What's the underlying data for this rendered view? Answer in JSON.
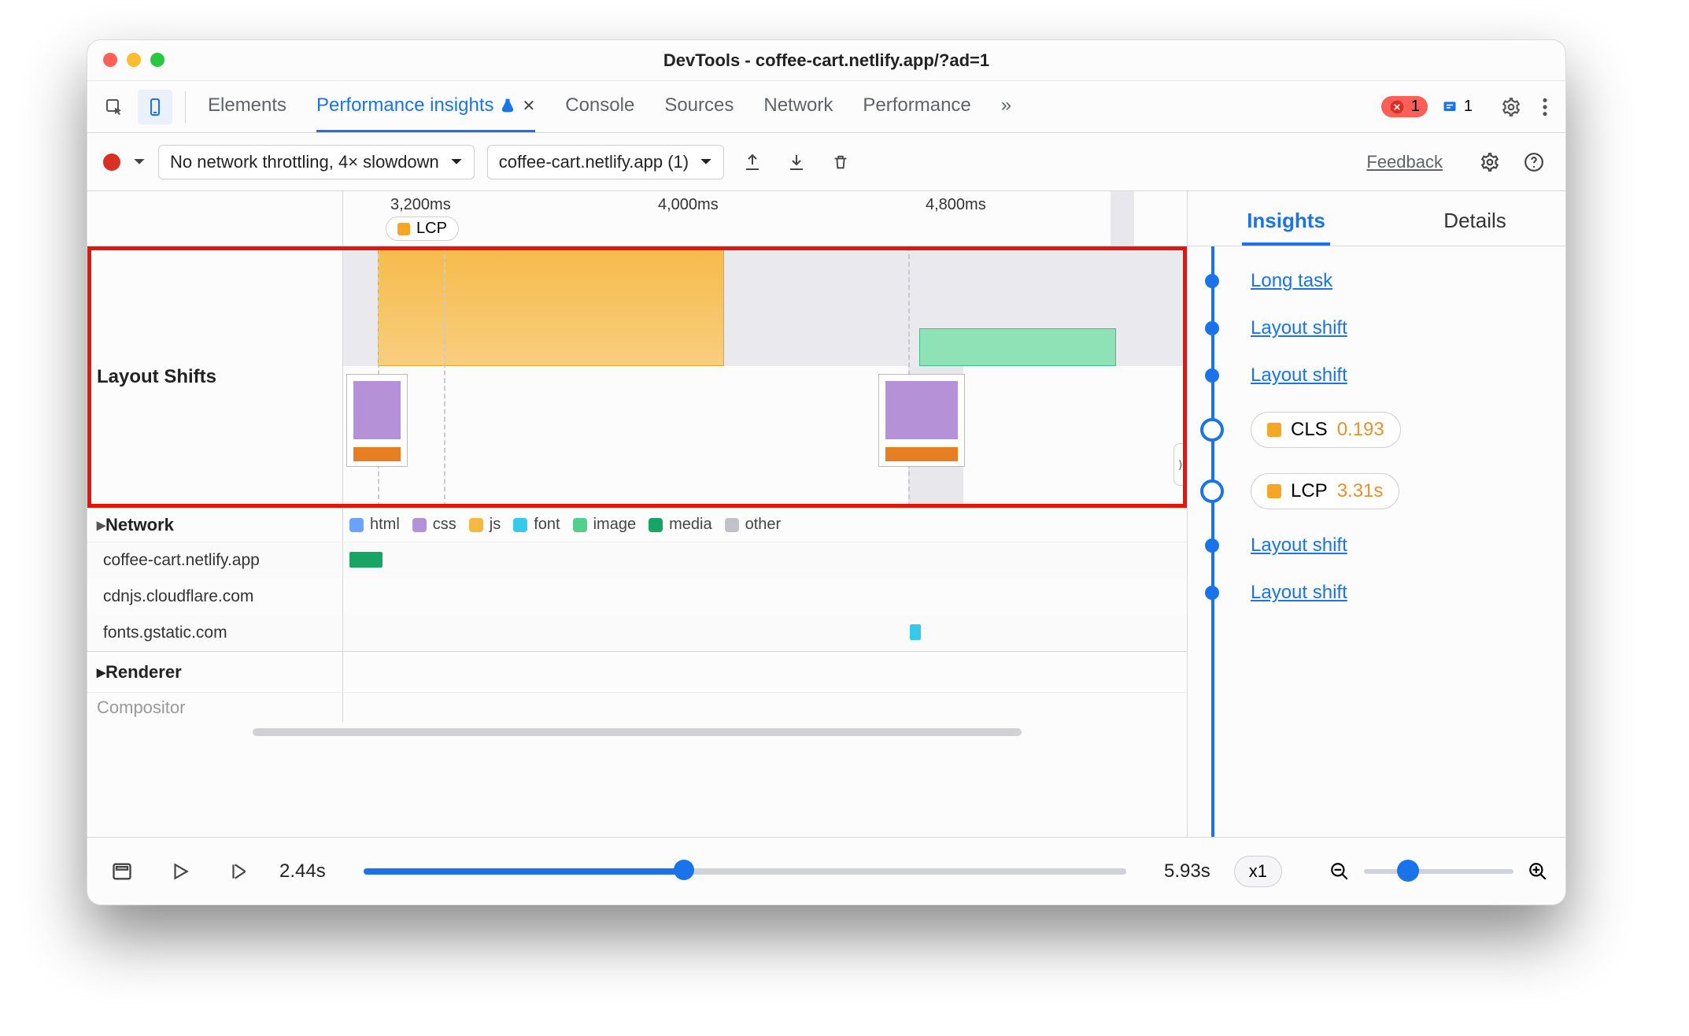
{
  "window": {
    "title": "DevTools - coffee-cart.netlify.app/?ad=1"
  },
  "tabs": {
    "elements": "Elements",
    "perfInsights": "Performance insights",
    "console": "Console",
    "sources": "Sources",
    "network": "Network",
    "performance": "Performance",
    "moreGlyph": "»",
    "errors": "1",
    "issues": "1"
  },
  "toolbar": {
    "throttle": "No network throttling, 4× slowdown",
    "recording": "coffee-cart.netlify.app (1)",
    "feedback": "Feedback"
  },
  "timeline": {
    "ticks": {
      "t1": "3,200ms",
      "t2": "4,000ms",
      "t3": "4,800ms"
    },
    "lcpChip": "LCP",
    "laneShift": "Layout Shifts",
    "netHeader": "Network",
    "legend": {
      "html": "html",
      "css": "css",
      "js": "js",
      "font": "font",
      "image": "image",
      "media": "media",
      "other": "other"
    },
    "hosts": {
      "h1": "coffee-cart.netlify.app",
      "h2": "cdnjs.cloudflare.com",
      "h3": "fonts.gstatic.com"
    },
    "renderer": "Renderer",
    "compositor": "Compositor"
  },
  "playback": {
    "start": "2.44s",
    "end": "5.93s",
    "rate": "x1"
  },
  "side": {
    "tabInsights": "Insights",
    "tabDetails": "Details",
    "items": {
      "longTask": "Long task",
      "layoutShift": "Layout shift",
      "cls": {
        "label": "CLS",
        "value": "0.193"
      },
      "lcp": {
        "label": "LCP",
        "value": "3.31s"
      }
    }
  },
  "colors": {
    "blue": "#1a73e8",
    "orange": "#f5a623",
    "red": "#d93025",
    "green": "#28c840"
  }
}
